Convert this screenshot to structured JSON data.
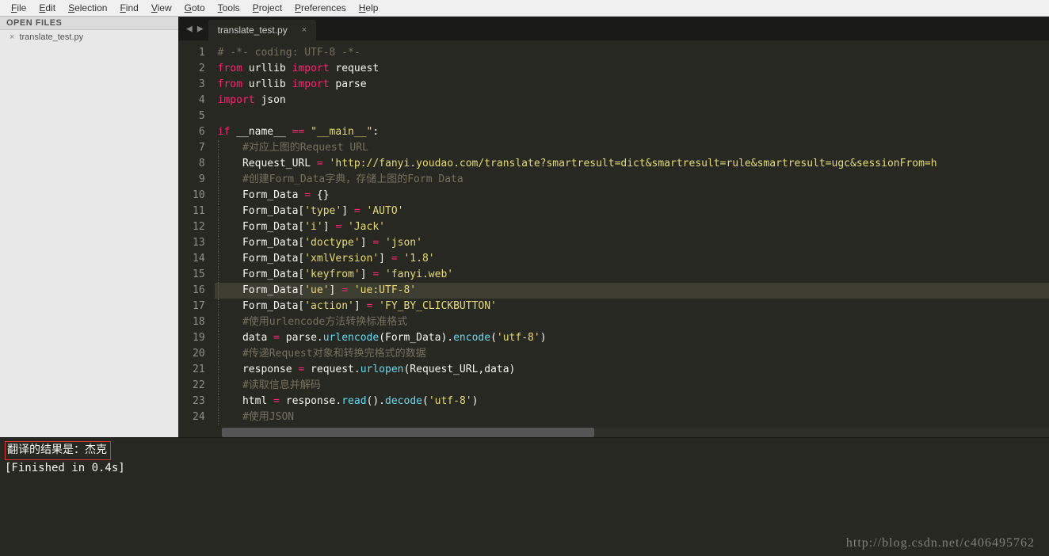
{
  "menu": [
    "File",
    "Edit",
    "Selection",
    "Find",
    "View",
    "Goto",
    "Tools",
    "Project",
    "Preferences",
    "Help"
  ],
  "sidebar": {
    "header": "OPEN FILES",
    "files": [
      "translate_test.py"
    ]
  },
  "tabs": {
    "active": {
      "label": "translate_test.py"
    }
  },
  "highlight_line": 16,
  "code_lines": [
    [
      {
        "t": "# -*- coding: UTF-8 -*-",
        "c": "c-comment"
      }
    ],
    [
      {
        "t": "from",
        "c": "c-kw"
      },
      {
        "t": " urllib ",
        "c": "c-id"
      },
      {
        "t": "import",
        "c": "c-kw"
      },
      {
        "t": " request",
        "c": "c-id"
      }
    ],
    [
      {
        "t": "from",
        "c": "c-kw"
      },
      {
        "t": " urllib ",
        "c": "c-id"
      },
      {
        "t": "import",
        "c": "c-kw"
      },
      {
        "t": " parse",
        "c": "c-id"
      }
    ],
    [
      {
        "t": "import",
        "c": "c-kw"
      },
      {
        "t": " json",
        "c": "c-id"
      }
    ],
    [],
    [
      {
        "t": "if",
        "c": "c-kw"
      },
      {
        "t": " __name__ ",
        "c": "c-decorator"
      },
      {
        "t": "==",
        "c": "c-kw"
      },
      {
        "t": " ",
        "c": ""
      },
      {
        "t": "\"__main__\"",
        "c": "c-str"
      },
      {
        "t": ":",
        "c": "c-id"
      }
    ],
    [
      {
        "t": "    ",
        "c": ""
      },
      {
        "t": "#对应上图的Request URL",
        "c": "c-comment"
      }
    ],
    [
      {
        "t": "    Request_URL ",
        "c": "c-id"
      },
      {
        "t": "=",
        "c": "c-kw"
      },
      {
        "t": " ",
        "c": ""
      },
      {
        "t": "'http://fanyi.youdao.com/translate?smartresult=dict&smartresult=rule&smartresult=ugc&sessionFrom=h",
        "c": "c-str"
      }
    ],
    [
      {
        "t": "    ",
        "c": ""
      },
      {
        "t": "#创建Form_Data字典，存储上图的Form Data",
        "c": "c-comment"
      }
    ],
    [
      {
        "t": "    Form_Data ",
        "c": "c-id"
      },
      {
        "t": "=",
        "c": "c-kw"
      },
      {
        "t": " {}",
        "c": "c-id"
      }
    ],
    [
      {
        "t": "    Form_Data[",
        "c": "c-id"
      },
      {
        "t": "'type'",
        "c": "c-str"
      },
      {
        "t": "] ",
        "c": "c-id"
      },
      {
        "t": "=",
        "c": "c-kw"
      },
      {
        "t": " ",
        "c": ""
      },
      {
        "t": "'AUTO'",
        "c": "c-str"
      }
    ],
    [
      {
        "t": "    Form_Data[",
        "c": "c-id"
      },
      {
        "t": "'i'",
        "c": "c-str"
      },
      {
        "t": "] ",
        "c": "c-id"
      },
      {
        "t": "=",
        "c": "c-kw"
      },
      {
        "t": " ",
        "c": ""
      },
      {
        "t": "'Jack'",
        "c": "c-str"
      }
    ],
    [
      {
        "t": "    Form_Data[",
        "c": "c-id"
      },
      {
        "t": "'doctype'",
        "c": "c-str"
      },
      {
        "t": "] ",
        "c": "c-id"
      },
      {
        "t": "=",
        "c": "c-kw"
      },
      {
        "t": " ",
        "c": ""
      },
      {
        "t": "'json'",
        "c": "c-str"
      }
    ],
    [
      {
        "t": "    Form_Data[",
        "c": "c-id"
      },
      {
        "t": "'xmlVersion'",
        "c": "c-str"
      },
      {
        "t": "] ",
        "c": "c-id"
      },
      {
        "t": "=",
        "c": "c-kw"
      },
      {
        "t": " ",
        "c": ""
      },
      {
        "t": "'1.8'",
        "c": "c-str"
      }
    ],
    [
      {
        "t": "    Form_Data[",
        "c": "c-id"
      },
      {
        "t": "'keyfrom'",
        "c": "c-str"
      },
      {
        "t": "] ",
        "c": "c-id"
      },
      {
        "t": "=",
        "c": "c-kw"
      },
      {
        "t": " ",
        "c": ""
      },
      {
        "t": "'fanyi.web'",
        "c": "c-str"
      }
    ],
    [
      {
        "t": "    Form_Data[",
        "c": "c-id"
      },
      {
        "t": "'ue'",
        "c": "c-str"
      },
      {
        "t": "] ",
        "c": "c-id"
      },
      {
        "t": "=",
        "c": "c-kw"
      },
      {
        "t": " ",
        "c": ""
      },
      {
        "t": "'ue:UTF-8'",
        "c": "c-str"
      }
    ],
    [
      {
        "t": "    Form_Data[",
        "c": "c-id"
      },
      {
        "t": "'action'",
        "c": "c-str"
      },
      {
        "t": "] ",
        "c": "c-id"
      },
      {
        "t": "=",
        "c": "c-kw"
      },
      {
        "t": " ",
        "c": ""
      },
      {
        "t": "'FY_BY_CLICKBUTTON'",
        "c": "c-str"
      }
    ],
    [
      {
        "t": "    ",
        "c": ""
      },
      {
        "t": "#使用urlencode方法转换标准格式",
        "c": "c-comment"
      }
    ],
    [
      {
        "t": "    data ",
        "c": "c-id"
      },
      {
        "t": "=",
        "c": "c-kw"
      },
      {
        "t": " parse.",
        "c": "c-id"
      },
      {
        "t": "urlencode",
        "c": "c-func"
      },
      {
        "t": "(Form_Data).",
        "c": "c-id"
      },
      {
        "t": "encode",
        "c": "c-func"
      },
      {
        "t": "(",
        "c": "c-id"
      },
      {
        "t": "'utf-8'",
        "c": "c-str"
      },
      {
        "t": ")",
        "c": "c-id"
      }
    ],
    [
      {
        "t": "    ",
        "c": ""
      },
      {
        "t": "#传递Request对象和转换完格式的数据",
        "c": "c-comment"
      }
    ],
    [
      {
        "t": "    response ",
        "c": "c-id"
      },
      {
        "t": "=",
        "c": "c-kw"
      },
      {
        "t": " request.",
        "c": "c-id"
      },
      {
        "t": "urlopen",
        "c": "c-func"
      },
      {
        "t": "(Request_URL,data)",
        "c": "c-id"
      }
    ],
    [
      {
        "t": "    ",
        "c": ""
      },
      {
        "t": "#读取信息并解码",
        "c": "c-comment"
      }
    ],
    [
      {
        "t": "    html ",
        "c": "c-id"
      },
      {
        "t": "=",
        "c": "c-kw"
      },
      {
        "t": " response.",
        "c": "c-id"
      },
      {
        "t": "read",
        "c": "c-func"
      },
      {
        "t": "().",
        "c": "c-id"
      },
      {
        "t": "decode",
        "c": "c-func"
      },
      {
        "t": "(",
        "c": "c-id"
      },
      {
        "t": "'utf-8'",
        "c": "c-str"
      },
      {
        "t": ")",
        "c": "c-id"
      }
    ],
    [
      {
        "t": "    ",
        "c": ""
      },
      {
        "t": "#使用JSON",
        "c": "c-comment"
      }
    ]
  ],
  "console": {
    "result_line": "翻译的结果是：杰克",
    "finished_line": "[Finished in 0.4s]"
  },
  "watermark": "http://blog.csdn.net/c406495762"
}
